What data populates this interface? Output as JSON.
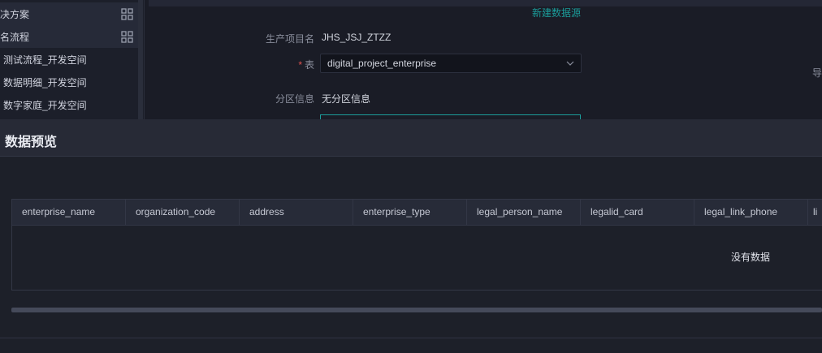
{
  "sidebar": {
    "items": [
      {
        "label": "决方案",
        "group": true
      },
      {
        "label": "名流程",
        "group": true
      },
      {
        "label": "测试流程_开发空间",
        "group": false
      },
      {
        "label": "数据明细_开发空间",
        "group": false
      },
      {
        "label": "数字家庭_开发空间",
        "group": false
      }
    ]
  },
  "form": {
    "new_datasource_link": "新建数据源",
    "project_label": "生产项目名",
    "project_value": "JHS_JSJ_ZTZZ",
    "table_label": "表",
    "table_value": "digital_project_enterprise",
    "partition_label": "分区信息",
    "partition_value": "无分区信息",
    "edge_text": "导"
  },
  "modal": {
    "title": "数据预览",
    "columns": [
      "enterprise_name",
      "organization_code",
      "address",
      "enterprise_type",
      "legal_person_name",
      "legalid_card",
      "legal_link_phone",
      "li"
    ],
    "empty_text": "没有数据"
  },
  "colors": {
    "accent": "#1b9c9a",
    "required": "#e0524f",
    "modal_bg": "#1d2029",
    "header_bg": "#272a36"
  }
}
